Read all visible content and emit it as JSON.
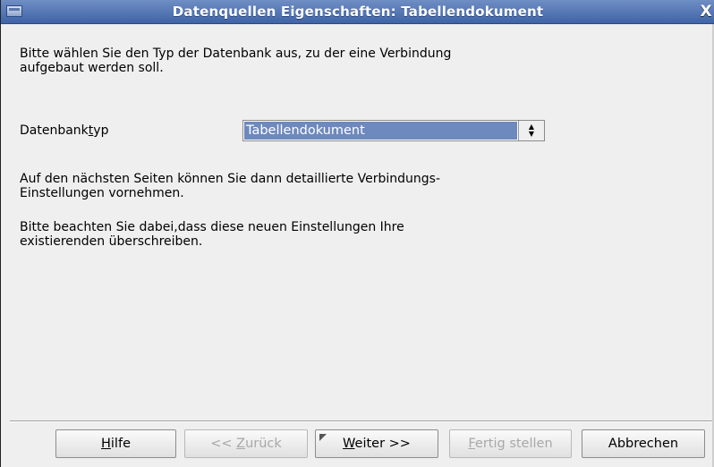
{
  "window": {
    "title": "Datenquellen Eigenschaften: Tabellendokument",
    "close_symbol": "X"
  },
  "main": {
    "intro_text_line1": "Bitte wählen Sie den Typ der Datenbank aus, zu der eine Verbindung",
    "intro_text_line2": "aufgebaut werden soll.",
    "db_type_label_before": "Datenbank",
    "db_type_label_accel": "t",
    "db_type_label_after": "yp",
    "db_type_value": "Tabellendokument",
    "info1_line1": "Auf den nächsten Seiten können Sie dann detaillierte Verbindungs-",
    "info1_line2": "Einstellungen vornehmen.",
    "info2_line1": "Bitte beachten Sie dabei,dass diese neuen Einstellungen Ihre",
    "info2_line2": "existierenden überschreiben."
  },
  "buttons": {
    "help": {
      "accel": "H",
      "rest": "ilfe"
    },
    "back": {
      "prefix": "<< ",
      "accel": "Z",
      "rest": "urück",
      "disabled": true
    },
    "next": {
      "accel": "W",
      "rest": "eiter >>",
      "disabled": false
    },
    "finish": {
      "accel": "F",
      "rest": "ertig stellen",
      "disabled": true
    },
    "cancel": {
      "label": "Abbrechen"
    }
  },
  "icons": {
    "window_menu": "window-menu-icon",
    "spin": "spin-arrows-icon",
    "default_marker": "default-button-marker-icon"
  },
  "colors": {
    "titlebar": "#4e71b2",
    "selection": "#6d89bd",
    "dialog_bg": "#efefef"
  }
}
